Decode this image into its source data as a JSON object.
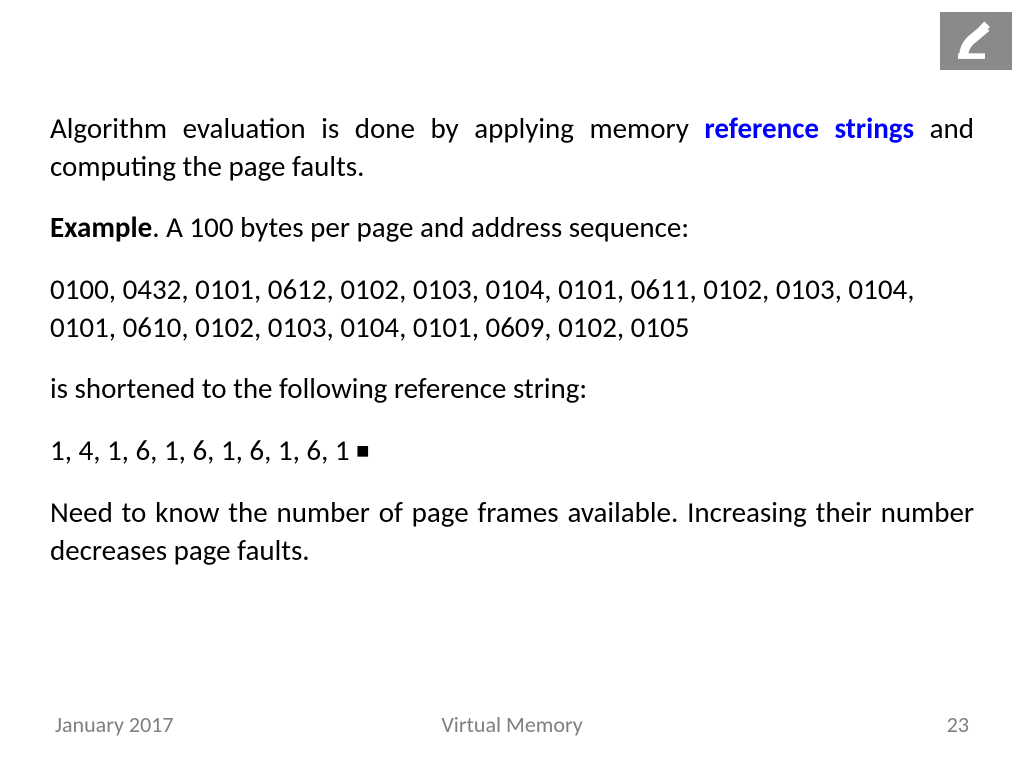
{
  "logo": {
    "name": "institution-logo"
  },
  "body": {
    "p1_a": "Algorithm evaluation is done by applying memory ",
    "p1_b": "reference strings",
    "p1_c": " and computing the page faults.",
    "p2_a": "Example",
    "p2_b": ". A 100 bytes per page and address sequence:",
    "p3": "0100, 0432, 0101, 0612, 0102, 0103, 0104, 0101, 0611, 0102, 0103, 0104, 0101, 0610, 0102, 0103, 0104, 0101, 0609, 0102, 0105",
    "p4": "is shortened to the following reference string:",
    "p5": "1, 4, 1, 6, 1, 6, 1, 6, 1, 6, 1 ",
    "p5_end": "■",
    "p6": "Need to know the number of page frames available. Increasing their number decreases page faults."
  },
  "footer": {
    "date": "January 2017",
    "title": "Virtual Memory",
    "page": "23"
  }
}
